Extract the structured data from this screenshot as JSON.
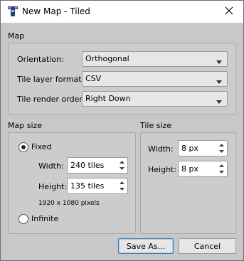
{
  "window": {
    "title": "New Map - Tiled"
  },
  "icons": {
    "app": "tiled-app-icon",
    "close": "close-icon",
    "dropdown": "chevron-down-icon",
    "spin_up": "spin-up-icon",
    "spin_down": "spin-down-icon"
  },
  "map": {
    "section": "Map",
    "orientation": {
      "label": "Orientation:",
      "value": "Orthogonal"
    },
    "layer_format": {
      "label": "Tile layer format:",
      "value": "CSV"
    },
    "render_order": {
      "label": "Tile render order:",
      "value": "Right Down"
    }
  },
  "map_size": {
    "section": "Map size",
    "fixed_label": "Fixed",
    "fixed_checked": true,
    "width": {
      "label": "Width:",
      "value": "240 tiles"
    },
    "height": {
      "label": "Height:",
      "value": "135 tiles"
    },
    "pixels": "1920 x 1080 pixels",
    "infinite_label": "Infinite",
    "infinite_checked": false
  },
  "tile_size": {
    "section": "Tile size",
    "width": {
      "label": "Width:",
      "value": "8 px"
    },
    "height": {
      "label": "Height:",
      "value": "8 px"
    }
  },
  "buttons": {
    "save_as": "Save As...",
    "cancel": "Cancel"
  }
}
